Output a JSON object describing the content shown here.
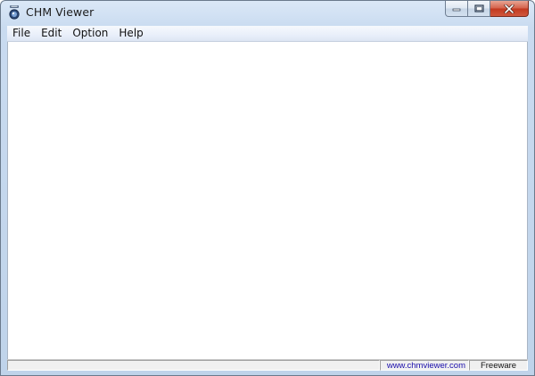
{
  "window": {
    "title": "CHM Viewer",
    "app_icon": "chm-viewer-icon"
  },
  "caption_buttons": {
    "minimize_icon": "minimize-icon",
    "maximize_icon": "maximize-icon",
    "close_icon": "close-icon"
  },
  "menu": {
    "items": [
      {
        "label": "File"
      },
      {
        "label": "Edit"
      },
      {
        "label": "Option"
      },
      {
        "label": "Help"
      }
    ]
  },
  "statusbar": {
    "main_text": "",
    "url": "www.chmviewer.com",
    "license": "Freeware"
  },
  "colors": {
    "link": "#1a0dab",
    "close_button": "#c2391f",
    "frame": "#bfd3ea"
  }
}
